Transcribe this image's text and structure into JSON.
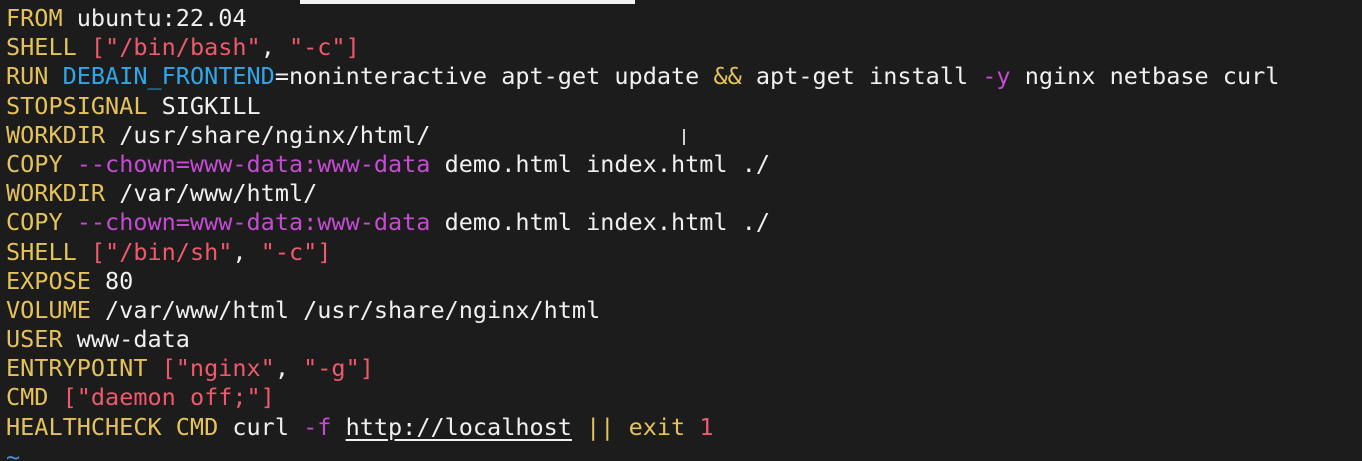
{
  "editor": {
    "lines": [
      [
        {
          "t": "kw",
          "v": "FROM"
        },
        {
          "t": "txt",
          "v": " ubuntu:22.04"
        }
      ],
      [
        {
          "t": "kw",
          "v": "SHELL"
        },
        {
          "t": "txt",
          "v": " "
        },
        {
          "t": "str",
          "v": "[\"/bin/bash\""
        },
        {
          "t": "txt",
          "v": ", "
        },
        {
          "t": "str",
          "v": "\"-c\"]"
        }
      ],
      [
        {
          "t": "kw",
          "v": "RUN"
        },
        {
          "t": "txt",
          "v": " "
        },
        {
          "t": "var",
          "v": "DEBAIN_FRONTEND"
        },
        {
          "t": "txt",
          "v": "=noninteractive apt-get update "
        },
        {
          "t": "op",
          "v": "&&"
        },
        {
          "t": "txt",
          "v": " apt-get install "
        },
        {
          "t": "flag",
          "v": "-y"
        },
        {
          "t": "txt",
          "v": " nginx netbase curl"
        }
      ],
      [
        {
          "t": "kw",
          "v": "STOPSIGNAL"
        },
        {
          "t": "txt",
          "v": " SIGKILL"
        }
      ],
      [
        {
          "t": "kw",
          "v": "WORKDIR"
        },
        {
          "t": "txt",
          "v": " /usr/share/nginx/html/"
        }
      ],
      [
        {
          "t": "kw",
          "v": "COPY"
        },
        {
          "t": "txt",
          "v": " "
        },
        {
          "t": "flag",
          "v": "--chown=www-data:www-data"
        },
        {
          "t": "txt",
          "v": " demo.html index.html ./"
        }
      ],
      [
        {
          "t": "kw",
          "v": "WORKDIR"
        },
        {
          "t": "txt",
          "v": " /var/www/html/"
        }
      ],
      [
        {
          "t": "kw",
          "v": "COPY"
        },
        {
          "t": "txt",
          "v": " "
        },
        {
          "t": "flag",
          "v": "--chown=www-data:www-data"
        },
        {
          "t": "txt",
          "v": " demo.html index.html ./"
        }
      ],
      [
        {
          "t": "kw",
          "v": "SHELL"
        },
        {
          "t": "txt",
          "v": " "
        },
        {
          "t": "str",
          "v": "[\"/bin/sh\""
        },
        {
          "t": "txt",
          "v": ", "
        },
        {
          "t": "str",
          "v": "\"-c\"]"
        }
      ],
      [
        {
          "t": "kw",
          "v": "EXPOSE"
        },
        {
          "t": "txt",
          "v": " 80"
        }
      ],
      [
        {
          "t": "kw",
          "v": "VOLUME"
        },
        {
          "t": "txt",
          "v": " /var/www/html /usr/share/nginx/html"
        }
      ],
      [
        {
          "t": "kw",
          "v": "USER"
        },
        {
          "t": "txt",
          "v": " www-data"
        }
      ],
      [
        {
          "t": "kw",
          "v": "ENTRYPOINT"
        },
        {
          "t": "txt",
          "v": " "
        },
        {
          "t": "str",
          "v": "[\"nginx\""
        },
        {
          "t": "txt",
          "v": ", "
        },
        {
          "t": "str",
          "v": "\"-g\"]"
        }
      ],
      [
        {
          "t": "kw",
          "v": "CMD"
        },
        {
          "t": "txt",
          "v": " "
        },
        {
          "t": "str",
          "v": "[\"daemon off;\"]"
        }
      ],
      [
        {
          "t": "kw",
          "v": "HEALTHCHECK CMD"
        },
        {
          "t": "txt",
          "v": " curl "
        },
        {
          "t": "flag",
          "v": "-f"
        },
        {
          "t": "txt",
          "v": " "
        },
        {
          "t": "url",
          "v": "http://localhost"
        },
        {
          "t": "txt",
          "v": " "
        },
        {
          "t": "op",
          "v": "||"
        },
        {
          "t": "txt",
          "v": " "
        },
        {
          "t": "kw",
          "v": "exit"
        },
        {
          "t": "txt",
          "v": " "
        },
        {
          "t": "num",
          "v": "1"
        }
      ]
    ],
    "tilde": "~"
  },
  "colors": {
    "background": "#1c1c1c",
    "keyword": "#e6c25a",
    "string": "#f0596b",
    "flag": "#c64bd4",
    "variable": "#31a6e8",
    "text": "#f0f0f0"
  }
}
